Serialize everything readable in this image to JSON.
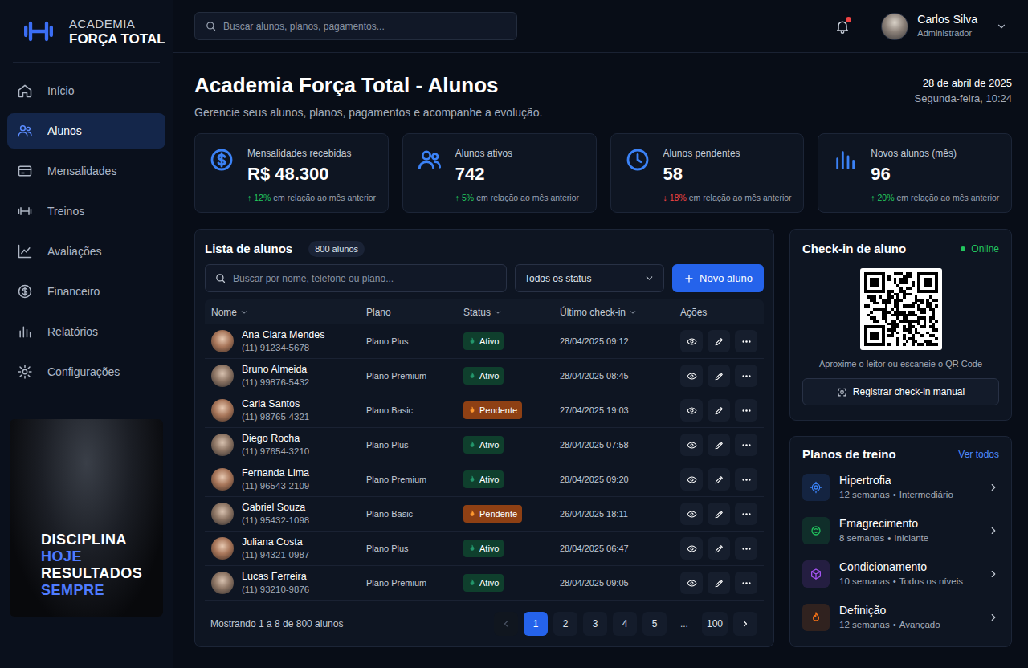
{
  "brand": {
    "line1": "ACADEMIA",
    "line2": "FORÇA TOTAL"
  },
  "search": {
    "placeholder": "Buscar alunos, planos, pagamentos..."
  },
  "notifications": {
    "unread": true
  },
  "user": {
    "name": "Carlos Silva",
    "role": "Administrador"
  },
  "sidebar": {
    "items": [
      {
        "label": "Início",
        "selected": false
      },
      {
        "label": "Alunos",
        "selected": true
      },
      {
        "label": "Mensalidades",
        "selected": false
      },
      {
        "label": "Treinos",
        "selected": false
      },
      {
        "label": "Avaliações",
        "selected": false
      },
      {
        "label": "Financeiro",
        "selected": false
      },
      {
        "label": "Relatórios",
        "selected": false
      },
      {
        "label": "Configurações",
        "selected": false
      }
    ]
  },
  "promo": {
    "lines": [
      {
        "text": "DISCIPLINA",
        "color": "#ffffff"
      },
      {
        "text": "HOJE",
        "color": "#4f7cff"
      },
      {
        "text": "RESULTADOS",
        "color": "#ffffff"
      },
      {
        "text": "SEMPRE",
        "color": "#4f7cff"
      }
    ]
  },
  "page": {
    "title": "Academia Força Total - Alunos",
    "subtitle": "Gerencie seus alunos, planos, pagamentos e acompanhe a evolução.",
    "date": "28 de abril de 2025",
    "time": "Segunda-feira, 10:24"
  },
  "stats": [
    {
      "label": "Mensalidades recebidas",
      "value": "R$ 48.300",
      "arrow": "↑",
      "change": "12%",
      "note": "em relação ao mês anterior",
      "color": "#22c55e"
    },
    {
      "label": "Alunos ativos",
      "value": "742",
      "arrow": "↑",
      "change": "5%",
      "note": "em relação ao mês anterior",
      "color": "#22c55e"
    },
    {
      "label": "Alunos pendentes",
      "value": "58",
      "arrow": "↓",
      "change": "18%",
      "note": "em relação ao mês anterior",
      "color": "#ef4444"
    },
    {
      "label": "Novos alunos (mês)",
      "value": "96",
      "arrow": "↑",
      "change": "20%",
      "note": "em relação ao mês anterior",
      "color": "#22c55e"
    }
  ],
  "students": {
    "title": "Lista de alunos",
    "count": "800 alunos",
    "search_placeholder": "Buscar por nome, telefone ou plano...",
    "filter": "Todos os status",
    "new_button": "Novo aluno",
    "columns": [
      {
        "label": "Nome",
        "sortable": true
      },
      {
        "label": "Plano",
        "sortable": false
      },
      {
        "label": "Status",
        "sortable": true
      },
      {
        "label": "Último check-in",
        "sortable": true
      },
      {
        "label": "Ações",
        "sortable": false
      }
    ],
    "rows": [
      {
        "name": "Ana Clara Mendes",
        "phone": "(11) 91234-5678",
        "plan": "Plano Plus",
        "status": "Ativo",
        "color": "#0f3f2d",
        "checkin": "28/04/2025 09:12"
      },
      {
        "name": "Bruno Almeida",
        "phone": "(11) 99876-5432",
        "plan": "Plano Premium",
        "status": "Ativo",
        "color": "#0f3f2d",
        "checkin": "28/04/2025 08:45"
      },
      {
        "name": "Carla Santos",
        "phone": "(11) 98765-4321",
        "plan": "Plano Basic",
        "status": "Pendente",
        "color": "#8e4014",
        "checkin": "27/04/2025 19:03"
      },
      {
        "name": "Diego Rocha",
        "phone": "(11) 97654-3210",
        "plan": "Plano Plus",
        "status": "Ativo",
        "color": "#0f3f2d",
        "checkin": "28/04/2025 07:58"
      },
      {
        "name": "Fernanda Lima",
        "phone": "(11) 96543-2109",
        "plan": "Plano Premium",
        "status": "Ativo",
        "color": "#0f3f2d",
        "checkin": "28/04/2025 09:20"
      },
      {
        "name": "Gabriel Souza",
        "phone": "(11) 95432-1098",
        "plan": "Plano Basic",
        "status": "Pendente",
        "color": "#8e4014",
        "checkin": "26/04/2025 18:11"
      },
      {
        "name": "Juliana Costa",
        "phone": "(11) 94321-0987",
        "plan": "Plano Plus",
        "status": "Ativo",
        "color": "#0f3f2d",
        "checkin": "28/04/2025 06:47"
      },
      {
        "name": "Lucas Ferreira",
        "phone": "(11) 93210-9876",
        "plan": "Plano Premium",
        "status": "Ativo",
        "color": "#0f3f2d",
        "checkin": "28/04/2025 09:05"
      }
    ],
    "footer": "Mostrando 1 a 8 de 800 alunos",
    "pagination": {
      "prev": {
        "disabled": true
      },
      "next": {
        "disabled": false
      },
      "pages": [
        {
          "label": "1",
          "kind": "page",
          "selected": true
        },
        {
          "label": "2",
          "kind": "page",
          "selected": false
        },
        {
          "label": "3",
          "kind": "page",
          "selected": false
        },
        {
          "label": "4",
          "kind": "page",
          "selected": false
        },
        {
          "label": "5",
          "kind": "page",
          "selected": false
        },
        {
          "label": "...",
          "kind": "ellipsis",
          "selected": false
        },
        {
          "label": "100",
          "kind": "page",
          "selected": false
        }
      ]
    }
  },
  "checkin": {
    "title": "Check-in de aluno",
    "status": "Online",
    "online": true,
    "hint": "Aproxime o leitor ou escaneie o QR Code",
    "button": "Registrar check-in manual"
  },
  "plans": {
    "title": "Planos de treino",
    "link": "Ver todos",
    "separator": "•",
    "items": [
      {
        "name": "Hipertrofia",
        "duration": "12 semanas",
        "difficulty": "Intermediário",
        "color": "#3b82f6"
      },
      {
        "name": "Emagrecimento",
        "duration": "8 semanas",
        "difficulty": "Iniciante",
        "color": "#22c55e"
      },
      {
        "name": "Condicionamento",
        "duration": "10 semanas",
        "difficulty": "Todos os níveis",
        "color": "#a855f7"
      },
      {
        "name": "Definição",
        "duration": "12 semanas",
        "difficulty": "Avançado",
        "color": "#f97316"
      }
    ]
  }
}
